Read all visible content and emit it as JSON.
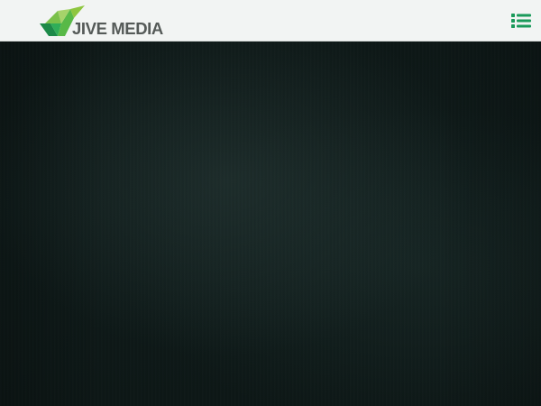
{
  "header": {
    "logo": {
      "text": "JIVE MEDIA",
      "icon": "jive-media-logo-mark",
      "colors": [
        "#8dc63f",
        "#39b54a",
        "#1e8b4a",
        "#00693e"
      ]
    },
    "menu_button": {
      "icon": "list-icon",
      "color": "#1a9a5a"
    }
  },
  "hero": {
    "background_color": "#0c1514"
  }
}
